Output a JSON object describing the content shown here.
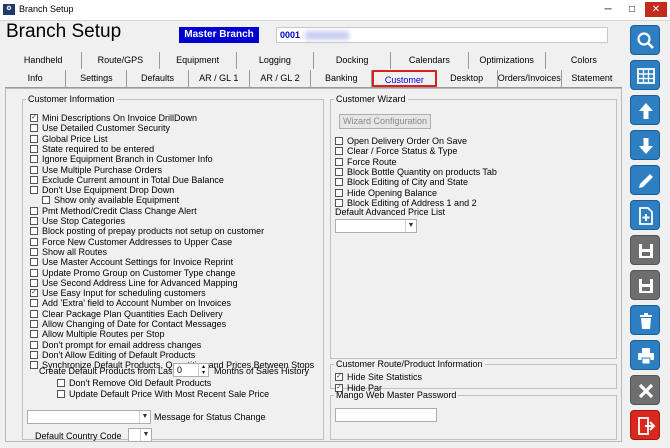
{
  "window": {
    "title": "Branch Setup",
    "app_icon": "gear-icon",
    "minimize": "─",
    "maximize": "□",
    "close": "✕"
  },
  "header": {
    "heading": "Branch Setup",
    "branch_name": "Master Branch",
    "branch_code": "0001"
  },
  "tabs_row1": [
    "Handheld",
    "Route/GPS",
    "Equipment",
    "Logging",
    "Docking",
    "Calendars",
    "Optimizations",
    "Colors"
  ],
  "tabs_row2": [
    "Info",
    "Settings",
    "Defaults",
    "AR / GL 1",
    "AR / GL 2",
    "Banking",
    "Customer",
    "Desktop",
    "Orders/Invoices",
    "Statement"
  ],
  "active_tab": "Customer",
  "customer_info": {
    "legend": "Customer Information",
    "options": [
      {
        "label": "Mini Descriptions On Invoice DrillDown",
        "checked": true
      },
      {
        "label": "Use Detailed Customer Security",
        "checked": false
      },
      {
        "label": "Global Price List",
        "checked": false
      },
      {
        "label": "State required to be entered",
        "checked": false
      },
      {
        "label": "Ignore Equipment Branch  in Customer Info",
        "checked": false
      },
      {
        "label": "Use Multiple Purchase Orders",
        "checked": false
      },
      {
        "label": "Exclude Current amount in Total Due Balance",
        "checked": false
      },
      {
        "label": "Don't Use Equipment Drop Down",
        "checked": false
      },
      {
        "label": "Show only available Equipment",
        "checked": false,
        "indent": true
      },
      {
        "label": "Pmt Method/Credit Class Change Alert",
        "checked": false
      },
      {
        "label": "Use Stop Categories",
        "checked": false
      },
      {
        "label": "Block posting of prepay products not setup on customer",
        "checked": false
      },
      {
        "label": "Force New Customer Addresses to Upper Case",
        "checked": false
      },
      {
        "label": "Show all Routes",
        "checked": false
      },
      {
        "label": "Use Master Account Settings for Invoice Reprint",
        "checked": false
      },
      {
        "label": "Update Promo Group on Customer Type change",
        "checked": false
      },
      {
        "label": "Use Second Address Line for Advanced Mapping",
        "checked": false
      },
      {
        "label": "Use Easy Input for scheduling customers",
        "checked": true
      },
      {
        "label": "Add 'Extra' field to Account Number on Invoices",
        "checked": false
      },
      {
        "label": "Clear Package Plan Quantities Each Delivery",
        "checked": false
      },
      {
        "label": "Allow Changing of Date for Contact Messages",
        "checked": false
      },
      {
        "label": "Allow Multiple Routes per Stop",
        "checked": false
      },
      {
        "label": "Don't prompt for email address changes",
        "checked": false
      },
      {
        "label": "Don't Allow Editing of Default Products",
        "checked": false
      },
      {
        "label": "Synchronize Default Products, Quantities and Prices Between Stops",
        "checked": false
      }
    ],
    "create_default_label": "Create Default Products from Last",
    "create_default_value": "0",
    "months_label": "Months of Sales History",
    "sub_options": [
      {
        "label": "Don't Remove Old Default Products",
        "checked": false
      },
      {
        "label": "Update Default Price With Most Recent Sale Price",
        "checked": false
      }
    ],
    "status_change_label": "Message for Status Change",
    "country_code_label": "Default Country Code"
  },
  "customer_wizard": {
    "legend": "Customer Wizard",
    "button": "Wizard Configuration",
    "options": [
      {
        "label": "Open Delivery Order On Save",
        "checked": false
      },
      {
        "label": "Clear / Force Status & Type",
        "checked": false
      },
      {
        "label": "Force Route",
        "checked": false
      },
      {
        "label": "Block Bottle Quantity on products Tab",
        "checked": false
      },
      {
        "label": "Block Editing of City and State",
        "checked": false
      },
      {
        "label": "Hide Opening Balance",
        "checked": false
      },
      {
        "label": "Block Editing of Address 1 and 2",
        "checked": false
      }
    ],
    "price_list_label": "Default Advanced Price List"
  },
  "route_product": {
    "legend": "Customer Route/Product Information",
    "options": [
      {
        "label": "Hide Site Statistics",
        "checked": true
      },
      {
        "label": "Hide Par",
        "checked": true
      }
    ]
  },
  "mango": {
    "legend": "Mango Web Master Password"
  },
  "sidebar": [
    "search-icon",
    "grid-icon",
    "arrow-up-icon",
    "arrow-down-icon",
    "edit-icon",
    "new-document-icon",
    "save-new-icon",
    "save-icon",
    "delete-icon",
    "print-icon",
    "cancel-icon",
    "exit-icon"
  ],
  "colors": {
    "accent_blue": "#2d7fc2",
    "exit_red": "#d9281e",
    "branch_blue": "#0000d0",
    "active_tab_border": "#d82020"
  }
}
